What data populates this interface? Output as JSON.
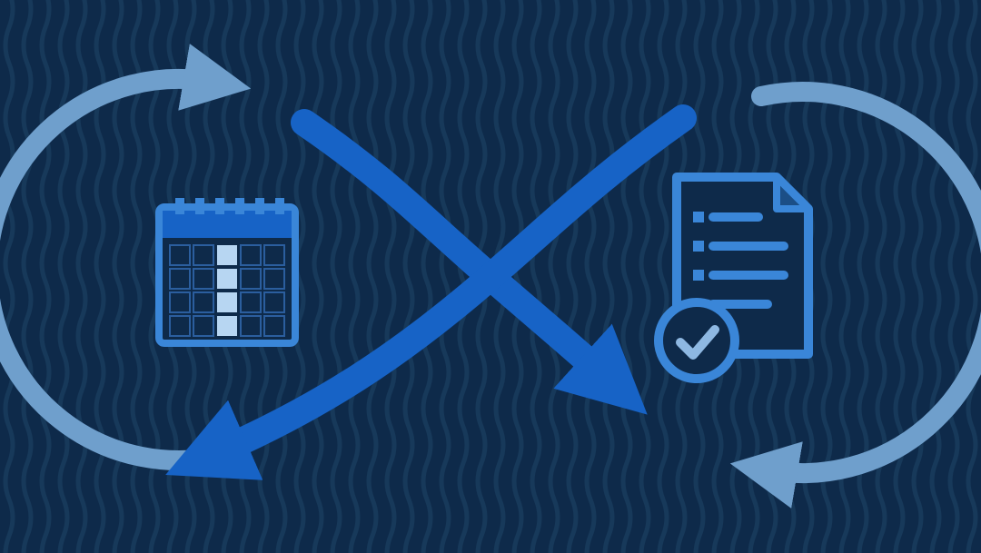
{
  "diagram": {
    "description_icon_left": "calendar",
    "description_icon_right": "checklist-document-with-checkmark",
    "arrow_style": "infinity-loop-with-outer-circular-arrows"
  },
  "palette": {
    "background": "#0e2a4a",
    "wave_pattern": "#163a5c",
    "arrow_inner": "#1763c6",
    "arrow_outer": "#6f9fcc",
    "icon_stroke": "#3a86d8",
    "calendar_highlight": "#b7d6f2",
    "calendar_header": "#1763c6",
    "calendar_cell": "#0e2a4a",
    "checkmark_circle_fill": "#0e2a4a"
  }
}
